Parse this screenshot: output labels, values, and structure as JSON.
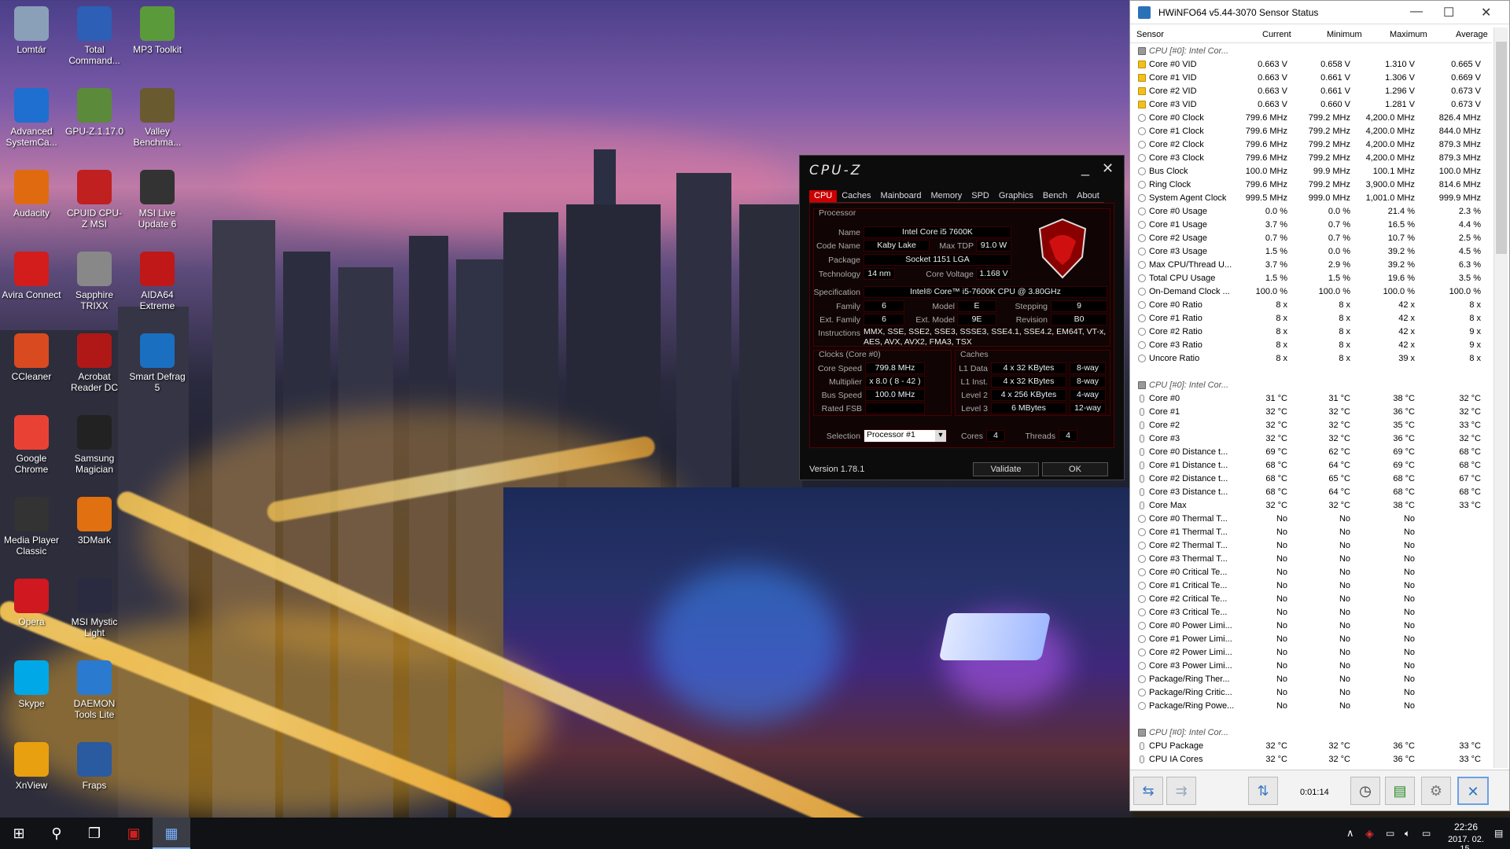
{
  "desktop": {
    "icons": [
      {
        "label": "Lomtár",
        "icon": "recycle-bin-icon",
        "color": "#8aa0b8"
      },
      {
        "label": "Total Command...",
        "icon": "floppy-icon",
        "color": "#2c5fb5"
      },
      {
        "label": "MP3 Toolkit",
        "icon": "tools-icon",
        "color": "#5b9a3a"
      },
      {
        "label": "Advanced SystemCa...",
        "icon": "gear-c-icon",
        "color": "#1e6fd0"
      },
      {
        "label": "GPU-Z.1.17.0",
        "icon": "gpu-icon",
        "color": "#5b8a3a"
      },
      {
        "label": "Valley Benchma...",
        "icon": "v-icon",
        "color": "#6a5a30"
      },
      {
        "label": "Audacity",
        "icon": "headphones-icon",
        "color": "#e06a10"
      },
      {
        "label": "CPUID CPU-Z MSI",
        "icon": "chip-icon",
        "color": "#c02020"
      },
      {
        "label": "MSI Live Update 6",
        "icon": "update-icon",
        "color": "#333333"
      },
      {
        "label": "Avira Connect",
        "icon": "umbrella-icon",
        "color": "#d31c1c"
      },
      {
        "label": "Sapphire TRIXX",
        "icon": "gauge-icon",
        "color": "#888888"
      },
      {
        "label": "AIDA64 Extreme",
        "icon": "64-icon",
        "color": "#c01818"
      },
      {
        "label": "CCleaner",
        "icon": "brush-icon",
        "color": "#d94a20"
      },
      {
        "label": "Acrobat Reader DC",
        "icon": "pdf-icon",
        "color": "#b01818"
      },
      {
        "label": "Smart Defrag 5",
        "icon": "defrag-icon",
        "color": "#1a6fc0"
      },
      {
        "label": "Google Chrome",
        "icon": "chrome-icon",
        "color": "#e94235"
      },
      {
        "label": "Samsung Magician",
        "icon": "ssd-icon",
        "color": "#222222"
      },
      {
        "label": "Media Player Classic",
        "icon": "film-icon",
        "color": "#333333"
      },
      {
        "label": "3DMark",
        "icon": "3dmark-icon",
        "color": "#e07010"
      },
      {
        "label": "Opera",
        "icon": "opera-icon",
        "color": "#d01820"
      },
      {
        "label": "MSI Mystic Light",
        "icon": "light-ring-icon",
        "color": "#2a2a40"
      },
      {
        "label": "Skype",
        "icon": "skype-icon",
        "color": "#00a8e8"
      },
      {
        "label": "DAEMON Tools Lite",
        "icon": "bolt-icon",
        "color": "#2a7ad0"
      },
      {
        "label": "XnView",
        "icon": "eye-icon",
        "color": "#e8a010"
      },
      {
        "label": "Fraps",
        "icon": "99-icon",
        "color": "#2a5aa0"
      }
    ]
  },
  "cpuz": {
    "title": "CPU-Z",
    "tabs": [
      "CPU",
      "Caches",
      "Mainboard",
      "Memory",
      "SPD",
      "Graphics",
      "Bench",
      "About"
    ],
    "active_tab": "CPU",
    "processor": {
      "heading": "Processor",
      "labels": {
        "name": "Name",
        "code_name": "Code Name",
        "max_tdp": "Max TDP",
        "package": "Package",
        "technology": "Technology",
        "core_voltage": "Core Voltage",
        "specification": "Specification",
        "family": "Family",
        "model": "Model",
        "stepping": "Stepping",
        "ext_family": "Ext. Family",
        "ext_model": "Ext. Model",
        "revision": "Revision",
        "instructions": "Instructions"
      },
      "name": "Intel Core i5 7600K",
      "code_name": "Kaby Lake",
      "max_tdp": "91.0 W",
      "package": "Socket 1151 LGA",
      "technology": "14 nm",
      "core_voltage": "1.168 V",
      "specification": "Intel® Core™ i5-7600K CPU @ 3.80GHz",
      "family": "6",
      "model": "E",
      "stepping": "9",
      "ext_family": "6",
      "ext_model": "9E",
      "revision": "B0",
      "instructions": "MMX, SSE, SSE2, SSE3, SSSE3, SSE4.1, SSE4.2, EM64T, VT-x, AES, AVX, AVX2, FMA3, TSX"
    },
    "clocks": {
      "heading": "Clocks (Core #0)",
      "labels": {
        "core_speed": "Core Speed",
        "multiplier": "Multiplier",
        "bus_speed": "Bus Speed",
        "rated_fsb": "Rated FSB"
      },
      "core_speed": "799.8 MHz",
      "multiplier": "x 8.0 ( 8 - 42 )",
      "bus_speed": "100.0 MHz",
      "rated_fsb": ""
    },
    "caches": {
      "heading": "Caches",
      "rows": [
        {
          "label": "L1 Data",
          "size": "4 x 32 KBytes",
          "way": "8-way"
        },
        {
          "label": "L1 Inst.",
          "size": "4 x 32 KBytes",
          "way": "8-way"
        },
        {
          "label": "Level 2",
          "size": "4 x 256 KBytes",
          "way": "4-way"
        },
        {
          "label": "Level 3",
          "size": "6 MBytes",
          "way": "12-way"
        }
      ]
    },
    "selection_label": "Selection",
    "selection": "Processor #1",
    "cores_label": "Cores",
    "cores": "4",
    "threads_label": "Threads",
    "threads": "4",
    "version": "Version 1.78.1",
    "validate": "Validate",
    "ok": "OK"
  },
  "hwinfo": {
    "title": "HWiNFO64 v5.44-3070 Sensor Status",
    "columns": [
      "Sensor",
      "Current",
      "Minimum",
      "Maximum",
      "Average"
    ],
    "rows": [
      {
        "t": "sec",
        "n": "CPU [#0]: Intel Cor..."
      },
      {
        "t": "v",
        "n": "Core #0 VID",
        "c": "0.663 V",
        "mi": "0.658 V",
        "ma": "1.310 V",
        "a": "0.665 V"
      },
      {
        "t": "v",
        "n": "Core #1 VID",
        "c": "0.663 V",
        "mi": "0.661 V",
        "ma": "1.306 V",
        "a": "0.669 V"
      },
      {
        "t": "v",
        "n": "Core #2 VID",
        "c": "0.663 V",
        "mi": "0.661 V",
        "ma": "1.296 V",
        "a": "0.673 V"
      },
      {
        "t": "v",
        "n": "Core #3 VID",
        "c": "0.663 V",
        "mi": "0.660 V",
        "ma": "1.281 V",
        "a": "0.673 V"
      },
      {
        "t": "r",
        "n": "Core #0 Clock",
        "c": "799.6 MHz",
        "mi": "799.2 MHz",
        "ma": "4,200.0 MHz",
        "a": "826.4 MHz"
      },
      {
        "t": "r",
        "n": "Core #1 Clock",
        "c": "799.6 MHz",
        "mi": "799.2 MHz",
        "ma": "4,200.0 MHz",
        "a": "844.0 MHz"
      },
      {
        "t": "r",
        "n": "Core #2 Clock",
        "c": "799.6 MHz",
        "mi": "799.2 MHz",
        "ma": "4,200.0 MHz",
        "a": "879.3 MHz"
      },
      {
        "t": "r",
        "n": "Core #3 Clock",
        "c": "799.6 MHz",
        "mi": "799.2 MHz",
        "ma": "4,200.0 MHz",
        "a": "879.3 MHz"
      },
      {
        "t": "r",
        "n": "Bus Clock",
        "c": "100.0 MHz",
        "mi": "99.9 MHz",
        "ma": "100.1 MHz",
        "a": "100.0 MHz"
      },
      {
        "t": "r",
        "n": "Ring Clock",
        "c": "799.6 MHz",
        "mi": "799.2 MHz",
        "ma": "3,900.0 MHz",
        "a": "814.6 MHz"
      },
      {
        "t": "r",
        "n": "System Agent Clock",
        "c": "999.5 MHz",
        "mi": "999.0 MHz",
        "ma": "1,001.0 MHz",
        "a": "999.9 MHz"
      },
      {
        "t": "r",
        "n": "Core #0 Usage",
        "c": "0.0 %",
        "mi": "0.0 %",
        "ma": "21.4 %",
        "a": "2.3 %"
      },
      {
        "t": "r",
        "n": "Core #1 Usage",
        "c": "3.7 %",
        "mi": "0.7 %",
        "ma": "16.5 %",
        "a": "4.4 %"
      },
      {
        "t": "r",
        "n": "Core #2 Usage",
        "c": "0.7 %",
        "mi": "0.7 %",
        "ma": "10.7 %",
        "a": "2.5 %"
      },
      {
        "t": "r",
        "n": "Core #3 Usage",
        "c": "1.5 %",
        "mi": "0.0 %",
        "ma": "39.2 %",
        "a": "4.5 %"
      },
      {
        "t": "r",
        "n": "Max CPU/Thread U...",
        "c": "3.7 %",
        "mi": "2.9 %",
        "ma": "39.2 %",
        "a": "6.3 %"
      },
      {
        "t": "r",
        "n": "Total CPU Usage",
        "c": "1.5 %",
        "mi": "1.5 %",
        "ma": "19.6 %",
        "a": "3.5 %"
      },
      {
        "t": "r",
        "n": "On-Demand Clock ...",
        "c": "100.0 %",
        "mi": "100.0 %",
        "ma": "100.0 %",
        "a": "100.0 %"
      },
      {
        "t": "r",
        "n": "Core #0 Ratio",
        "c": "8 x",
        "mi": "8 x",
        "ma": "42 x",
        "a": "8 x"
      },
      {
        "t": "r",
        "n": "Core #1 Ratio",
        "c": "8 x",
        "mi": "8 x",
        "ma": "42 x",
        "a": "8 x"
      },
      {
        "t": "r",
        "n": "Core #2 Ratio",
        "c": "8 x",
        "mi": "8 x",
        "ma": "42 x",
        "a": "9 x"
      },
      {
        "t": "r",
        "n": "Core #3 Ratio",
        "c": "8 x",
        "mi": "8 x",
        "ma": "42 x",
        "a": "9 x"
      },
      {
        "t": "r",
        "n": "Uncore Ratio",
        "c": "8 x",
        "mi": "8 x",
        "ma": "39 x",
        "a": "8 x"
      },
      {
        "t": "gap"
      },
      {
        "t": "sec",
        "n": "CPU [#0]: Intel Cor..."
      },
      {
        "t": "t",
        "n": "Core #0",
        "c": "31 °C",
        "mi": "31 °C",
        "ma": "38 °C",
        "a": "32 °C"
      },
      {
        "t": "t",
        "n": "Core #1",
        "c": "32 °C",
        "mi": "32 °C",
        "ma": "36 °C",
        "a": "32 °C"
      },
      {
        "t": "t",
        "n": "Core #2",
        "c": "32 °C",
        "mi": "32 °C",
        "ma": "35 °C",
        "a": "33 °C"
      },
      {
        "t": "t",
        "n": "Core #3",
        "c": "32 °C",
        "mi": "32 °C",
        "ma": "36 °C",
        "a": "32 °C"
      },
      {
        "t": "t",
        "n": "Core #0 Distance t...",
        "c": "69 °C",
        "mi": "62 °C",
        "ma": "69 °C",
        "a": "68 °C"
      },
      {
        "t": "t",
        "n": "Core #1 Distance t...",
        "c": "68 °C",
        "mi": "64 °C",
        "ma": "69 °C",
        "a": "68 °C"
      },
      {
        "t": "t",
        "n": "Core #2 Distance t...",
        "c": "68 °C",
        "mi": "65 °C",
        "ma": "68 °C",
        "a": "67 °C"
      },
      {
        "t": "t",
        "n": "Core #3 Distance t...",
        "c": "68 °C",
        "mi": "64 °C",
        "ma": "68 °C",
        "a": "68 °C"
      },
      {
        "t": "t",
        "n": "Core Max",
        "c": "32 °C",
        "mi": "32 °C",
        "ma": "38 °C",
        "a": "33 °C"
      },
      {
        "t": "r",
        "n": "Core #0 Thermal T...",
        "c": "No",
        "mi": "No",
        "ma": "No",
        "a": ""
      },
      {
        "t": "r",
        "n": "Core #1 Thermal T...",
        "c": "No",
        "mi": "No",
        "ma": "No",
        "a": ""
      },
      {
        "t": "r",
        "n": "Core #2 Thermal T...",
        "c": "No",
        "mi": "No",
        "ma": "No",
        "a": ""
      },
      {
        "t": "r",
        "n": "Core #3 Thermal T...",
        "c": "No",
        "mi": "No",
        "ma": "No",
        "a": ""
      },
      {
        "t": "r",
        "n": "Core #0 Critical Te...",
        "c": "No",
        "mi": "No",
        "ma": "No",
        "a": ""
      },
      {
        "t": "r",
        "n": "Core #1 Critical Te...",
        "c": "No",
        "mi": "No",
        "ma": "No",
        "a": ""
      },
      {
        "t": "r",
        "n": "Core #2 Critical Te...",
        "c": "No",
        "mi": "No",
        "ma": "No",
        "a": ""
      },
      {
        "t": "r",
        "n": "Core #3 Critical Te...",
        "c": "No",
        "mi": "No",
        "ma": "No",
        "a": ""
      },
      {
        "t": "r",
        "n": "Core #0 Power Limi...",
        "c": "No",
        "mi": "No",
        "ma": "No",
        "a": ""
      },
      {
        "t": "r",
        "n": "Core #1 Power Limi...",
        "c": "No",
        "mi": "No",
        "ma": "No",
        "a": ""
      },
      {
        "t": "r",
        "n": "Core #2 Power Limi...",
        "c": "No",
        "mi": "No",
        "ma": "No",
        "a": ""
      },
      {
        "t": "r",
        "n": "Core #3 Power Limi...",
        "c": "No",
        "mi": "No",
        "ma": "No",
        "a": ""
      },
      {
        "t": "r",
        "n": "Package/Ring Ther...",
        "c": "No",
        "mi": "No",
        "ma": "No",
        "a": ""
      },
      {
        "t": "r",
        "n": "Package/Ring Critic...",
        "c": "No",
        "mi": "No",
        "ma": "No",
        "a": ""
      },
      {
        "t": "r",
        "n": "Package/Ring Powe...",
        "c": "No",
        "mi": "No",
        "ma": "No",
        "a": ""
      },
      {
        "t": "gap"
      },
      {
        "t": "sec",
        "n": "CPU [#0]: Intel Cor..."
      },
      {
        "t": "t",
        "n": "CPU Package",
        "c": "32 °C",
        "mi": "32 °C",
        "ma": "36 °C",
        "a": "33 °C"
      },
      {
        "t": "t",
        "n": "CPU IA Cores",
        "c": "32 °C",
        "mi": "32 °C",
        "ma": "36 °C",
        "a": "33 °C"
      }
    ],
    "timer": "0:01:14"
  },
  "taskbar": {
    "clock_time": "22:26",
    "clock_date": "2017. 02. 15."
  }
}
